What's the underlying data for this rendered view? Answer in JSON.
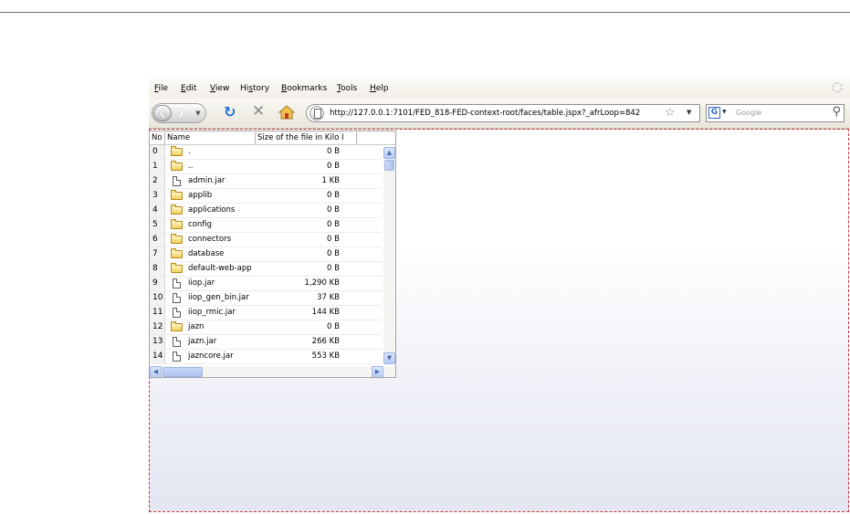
{
  "menu": [
    "File",
    "Edit",
    "View",
    "History",
    "Bookmarks",
    "Tools",
    "Help"
  ],
  "menu_mnemonics": [
    "F",
    "E",
    "V",
    "s",
    "B",
    "T",
    "H"
  ],
  "address_bar": {
    "url": "http://127.0.0.1:7101/FED_818-FED-context-root/faces/table.jspx?_afrLoop=842"
  },
  "search_bar": {
    "placeholder": "Google",
    "engine_letter": "G"
  },
  "icons": {
    "back": "back-arrow-icon",
    "forward": "forward-arrow-icon",
    "reload": "reload-icon",
    "stop": "stop-icon",
    "home": "home-icon",
    "page": "page-icon",
    "bookmark": "star-icon",
    "search": "magnifier-icon"
  },
  "table": {
    "headers": {
      "no": "No",
      "name": "Name",
      "size": "Size of the file in Kilo I"
    },
    "rows": [
      {
        "no": "0",
        "type": "folder",
        "name": ".",
        "size": "0 B"
      },
      {
        "no": "1",
        "type": "folder",
        "name": "..",
        "size": "0 B"
      },
      {
        "no": "2",
        "type": "file",
        "name": "admin.jar",
        "size": "1 KB"
      },
      {
        "no": "3",
        "type": "folder",
        "name": "applib",
        "size": "0 B"
      },
      {
        "no": "4",
        "type": "folder",
        "name": "applications",
        "size": "0 B"
      },
      {
        "no": "5",
        "type": "folder",
        "name": "config",
        "size": "0 B"
      },
      {
        "no": "6",
        "type": "folder",
        "name": "connectors",
        "size": "0 B"
      },
      {
        "no": "7",
        "type": "folder",
        "name": "database",
        "size": "0 B"
      },
      {
        "no": "8",
        "type": "folder",
        "name": "default-web-app",
        "size": "0 B"
      },
      {
        "no": "9",
        "type": "file",
        "name": "iiop.jar",
        "size": "1,290 KB"
      },
      {
        "no": "10",
        "type": "file",
        "name": "iiop_gen_bin.jar",
        "size": "37 KB"
      },
      {
        "no": "11",
        "type": "file",
        "name": "iiop_rmic.jar",
        "size": "144 KB"
      },
      {
        "no": "12",
        "type": "folder",
        "name": "jazn",
        "size": "0 B"
      },
      {
        "no": "13",
        "type": "file",
        "name": "jazn.jar",
        "size": "266 KB"
      },
      {
        "no": "14",
        "type": "file",
        "name": "jazncore.jar",
        "size": "553 KB"
      }
    ]
  },
  "colors": {
    "content_border": "#cc3333",
    "link_blue": "#1f6fd0",
    "scrollbar": "#b7cbf3"
  }
}
